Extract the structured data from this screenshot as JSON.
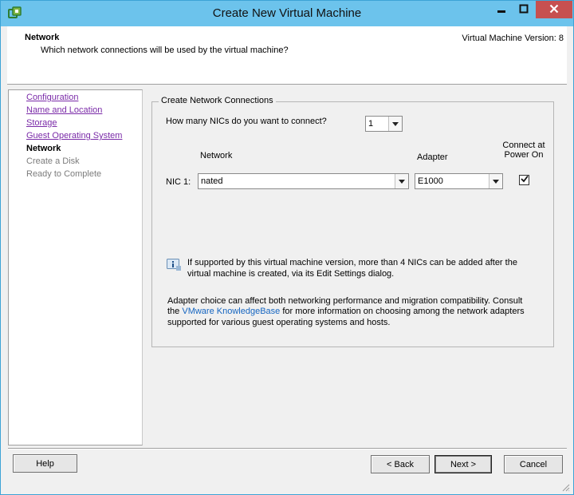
{
  "window": {
    "title": "Create New Virtual Machine"
  },
  "header": {
    "title": "Network",
    "subtitle": "Which network connections will be used by the virtual machine?",
    "version": "Virtual Machine Version: 8"
  },
  "sidebar": {
    "steps": [
      {
        "label": "Configuration",
        "state": "done"
      },
      {
        "label": "Name and Location",
        "state": "done"
      },
      {
        "label": "Storage",
        "state": "done"
      },
      {
        "label": "Guest Operating System",
        "state": "done"
      },
      {
        "label": "Network",
        "state": "current"
      },
      {
        "label": "Create a Disk",
        "state": "future"
      },
      {
        "label": "Ready to Complete",
        "state": "future"
      }
    ]
  },
  "main": {
    "group_title": "Create Network Connections",
    "nic_count_label": "How many NICs do you want to connect?",
    "nic_count_value": "1",
    "col_network": "Network",
    "col_adapter": "Adapter",
    "col_connect_line1": "Connect at",
    "col_connect_line2": "Power On",
    "nic1_label": "NIC 1:",
    "nic1_network": "nated",
    "nic1_adapter": "E1000",
    "nic1_connect_checked": true,
    "info_line1": "If supported by this virtual machine version, more than 4 NICs can be added after the",
    "info_line2": "virtual machine is created, via its Edit Settings dialog.",
    "note_line1": "Adapter choice can affect both networking performance and migration compatibility. Consult",
    "note_line2_pre": "the",
    "note_link": "VMware KnowledgeBase",
    "note_line2_post": "for more information on choosing among the network adapters",
    "note_line3": "supported for various guest operating systems and hosts."
  },
  "footer": {
    "help": "Help",
    "back": "< Back",
    "next": "Next >",
    "cancel": "Cancel"
  },
  "colors": {
    "titlebar": "#6cc3ec",
    "close_button": "#c75050",
    "link_visited": "#7a2aa8",
    "link": "#1565c0"
  },
  "icons": {
    "app": "vmware-icon",
    "minimize": "minimize-icon",
    "maximize": "maximize-icon",
    "close": "close-icon",
    "info": "info-icon",
    "dropdown": "chevron-down-icon",
    "checkmark": "checkmark-icon",
    "resize": "resize-grip-icon"
  }
}
